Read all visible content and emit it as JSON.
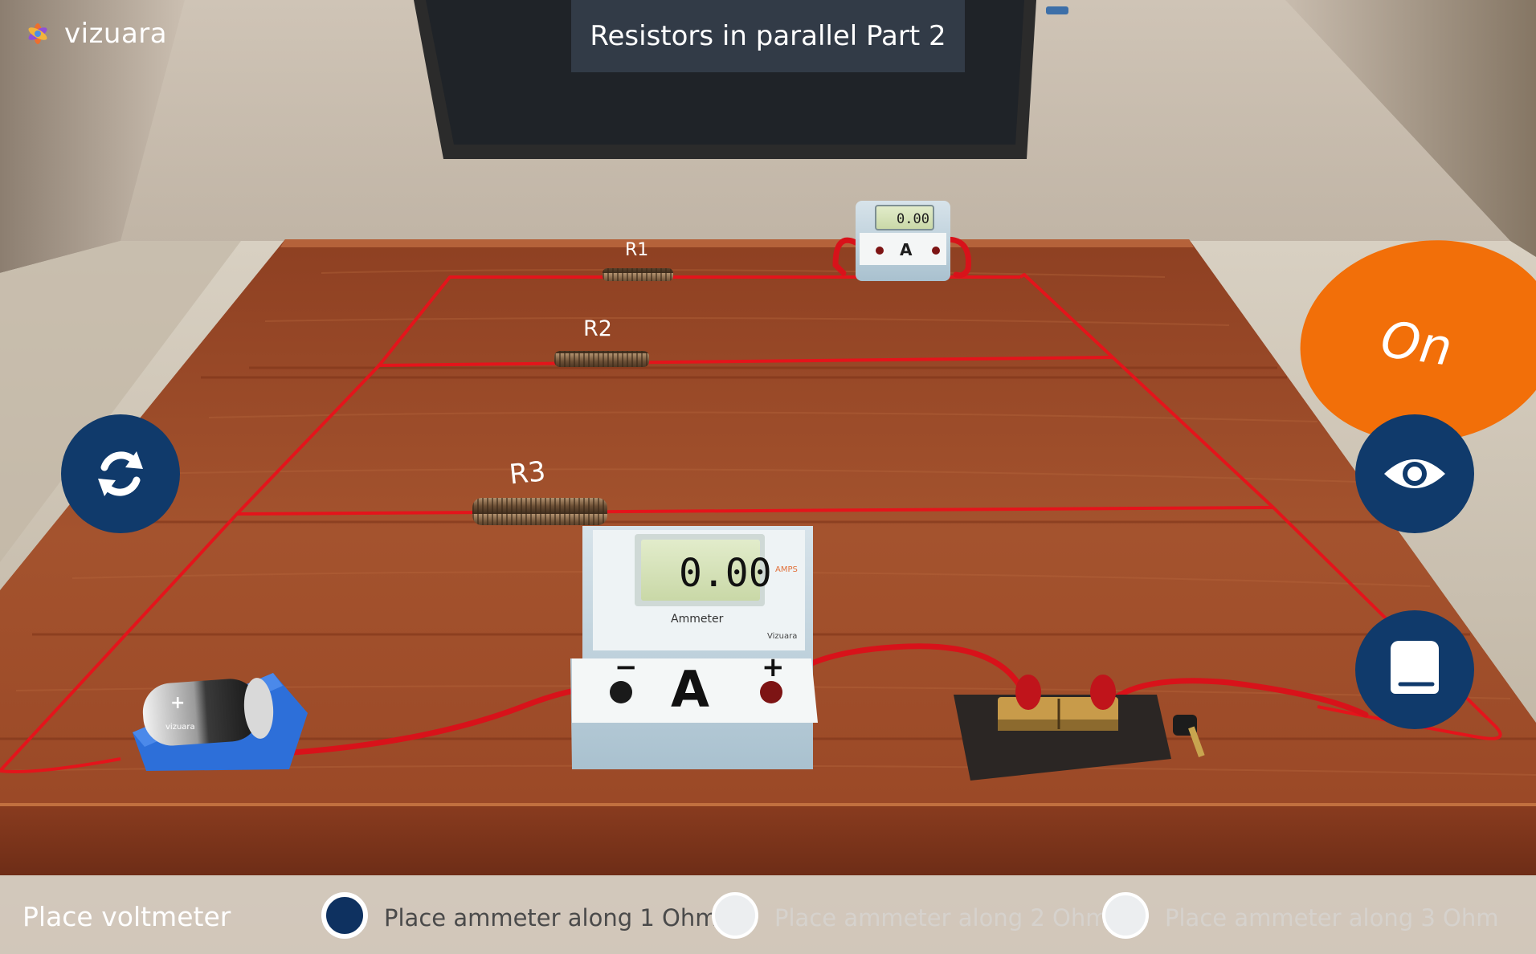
{
  "app": {
    "logo_text": "vizuara"
  },
  "header": {
    "title": "Resistors in parallel Part 2"
  },
  "scene": {
    "resistors": [
      {
        "label": "R1"
      },
      {
        "label": "R2"
      },
      {
        "label": "R3"
      }
    ],
    "main_ammeter": {
      "reading": "0.00",
      "unit": "AMPS",
      "name": "Ammeter",
      "symbol": "A",
      "brand": "Vizuara",
      "neg": "−",
      "pos": "+"
    },
    "small_ammeter": {
      "reading": "0.00",
      "symbol": "A"
    },
    "battery": {
      "brand": "vizuara",
      "pos": "+"
    }
  },
  "controls": {
    "on_label": "On",
    "reset_icon": "rotate-icon",
    "view_icon": "eye-icon",
    "book_icon": "book-icon"
  },
  "bottom_bar": {
    "place_voltmeter": "Place voltmeter",
    "options": [
      {
        "label": "Place ammeter along 1 Ohm",
        "selected": true
      },
      {
        "label": "Place ammeter along 2 Ohm",
        "selected": false
      },
      {
        "label": "Place ammeter along 3 Ohm",
        "selected": false
      }
    ]
  },
  "colors": {
    "accent_orange": "#f26f09",
    "button_navy": "#103a6b",
    "wire_red": "#e4141b",
    "table_wood": "#9b4a2a"
  }
}
